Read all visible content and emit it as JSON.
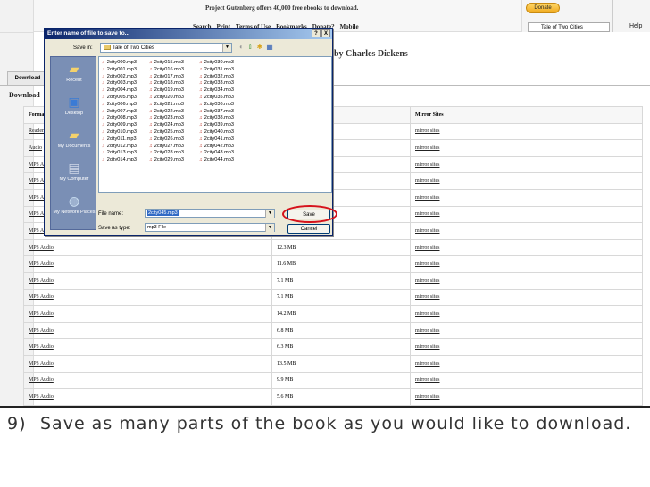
{
  "site": {
    "promo": "Project Gutenberg offers 40,000 free ebooks to download.",
    "nav": [
      "Search",
      "Print",
      "Terms of Use",
      "Bookmarks",
      "Donate?",
      "Mobile"
    ],
    "donate_label": "Donate",
    "search_value": "Tale of Two Cities",
    "help_label": "Help",
    "book_byline": "by Charles Dickens",
    "tab_label": "Download",
    "download_heading": "Download"
  },
  "table": {
    "headers": [
      "Format",
      "",
      "Mirror Sites"
    ],
    "rows": [
      {
        "format": "Readers",
        "size": "",
        "mirror": "mirror sites"
      },
      {
        "format": "Audio",
        "size": "",
        "mirror": "mirror sites"
      },
      {
        "format": "MP3 A",
        "size": "",
        "mirror": "mirror sites"
      },
      {
        "format": "MP3 A",
        "size": "",
        "mirror": "mirror sites"
      },
      {
        "format": "MP3 A",
        "size": "",
        "mirror": "mirror sites"
      },
      {
        "format": "MP3 A",
        "size": "",
        "mirror": "mirror sites"
      },
      {
        "format": "MP3 A",
        "size": "",
        "mirror": "mirror sites"
      },
      {
        "format": "MP3 Audio",
        "size": "12.3 MB",
        "mirror": "mirror sites"
      },
      {
        "format": "MP3 Audio",
        "size": "11.6 MB",
        "mirror": "mirror sites"
      },
      {
        "format": "MP3 Audio",
        "size": "7.1 MB",
        "mirror": "mirror sites"
      },
      {
        "format": "MP3 Audio",
        "size": "7.1 MB",
        "mirror": "mirror sites"
      },
      {
        "format": "MP3 Audio",
        "size": "14.2 MB",
        "mirror": "mirror sites"
      },
      {
        "format": "MP3 Audio",
        "size": "6.8 MB",
        "mirror": "mirror sites"
      },
      {
        "format": "MP3 Audio",
        "size": "6.3 MB",
        "mirror": "mirror sites"
      },
      {
        "format": "MP3 Audio",
        "size": "13.5 MB",
        "mirror": "mirror sites"
      },
      {
        "format": "MP3 Audio",
        "size": "9.9 MB",
        "mirror": "mirror sites"
      },
      {
        "format": "MP3 Audio",
        "size": "5.6 MB",
        "mirror": "mirror sites"
      }
    ]
  },
  "dialog": {
    "title": "Enter name of file to save to...",
    "title_buttons": [
      "?",
      "X"
    ],
    "save_in_label": "Save in:",
    "save_in_value": "Tale of Two Cities",
    "places": [
      "Recent",
      "Desktop",
      "My Documents",
      "My Computer",
      "My Network Places"
    ],
    "files": [
      [
        "2city000.mp3",
        "2city001.mp3",
        "2city002.mp3",
        "2city003.mp3",
        "2city004.mp3",
        "2city005.mp3",
        "2city006.mp3",
        "2city007.mp3",
        "2city008.mp3",
        "2city009.mp3",
        "2city010.mp3",
        "2city011.mp3",
        "2city012.mp3",
        "2city013.mp3",
        "2city014.mp3"
      ],
      [
        "2city015.mp3",
        "2city016.mp3",
        "2city017.mp3",
        "2city018.mp3",
        "2city019.mp3",
        "2city020.mp3",
        "2city021.mp3",
        "2city022.mp3",
        "2city023.mp3",
        "2city024.mp3",
        "2city025.mp3",
        "2city026.mp3",
        "2city027.mp3",
        "2city028.mp3",
        "2city029.mp3"
      ],
      [
        "2city030.mp3",
        "2city031.mp3",
        "2city032.mp3",
        "2city033.mp3",
        "2city034.mp3",
        "2city035.mp3",
        "2city036.mp3",
        "2city037.mp3",
        "2city038.mp3",
        "2city039.mp3",
        "2city040.mp3",
        "2city041.mp3",
        "2city042.mp3",
        "2city043.mp3",
        "2city044.mp3"
      ]
    ],
    "file_name_label": "File name:",
    "file_name_value": "2city045.mp3",
    "save_type_label": "Save as type:",
    "save_type_value": "mp3 File",
    "save_button": "Save",
    "cancel_button": "Cancel"
  },
  "caption": {
    "number": "9)",
    "text": "Save as many parts of the book as you would like to download."
  },
  "colors": {
    "highlight_circle": "#d6121b",
    "title_bar": "#0a246a"
  }
}
